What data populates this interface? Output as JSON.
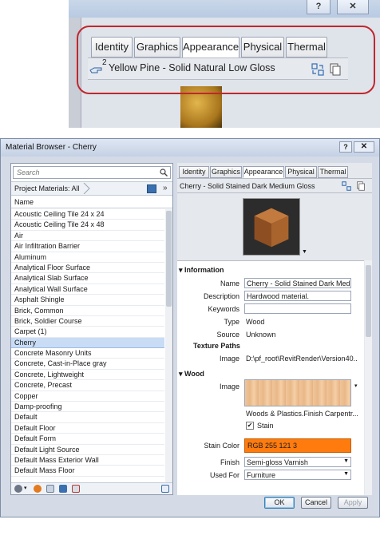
{
  "zoom": {
    "tabs": [
      "Identity",
      "Graphics",
      "Appearance",
      "Physical",
      "Thermal"
    ],
    "active_tab": "Appearance",
    "asset_superscript": "2",
    "asset_name": "Yellow Pine - Solid Natural Low Gloss",
    "help_button": "?",
    "close_button": "✕"
  },
  "dialog": {
    "title": "Material Browser - Cherry",
    "help_button": "?",
    "close_button": "✕",
    "search": {
      "placeholder": "Search"
    },
    "breadcrumb": "Project Materials: All",
    "expand_chevron": "»",
    "column_header": "Name",
    "materials": [
      "Acoustic Ceiling Tile 24 x 24",
      "Acoustic Ceiling Tile 24 x 48",
      "Air",
      "Air Infiltration Barrier",
      "Aluminum",
      "Analytical Floor Surface",
      "Analytical Slab Surface",
      "Analytical Wall Surface",
      "Asphalt Shingle",
      "Brick, Common",
      "Brick, Soldier Course",
      "Carpet (1)",
      "Cherry",
      "Concrete Masonry Units",
      "Concrete, Cast-in-Place gray",
      "Concrete, Lightweight",
      "Concrete, Precast",
      "Copper",
      "Damp-proofing",
      "Default",
      "Default Floor",
      "Default Form",
      "Default Light Source",
      "Default Mass Exterior Wall",
      "Default Mass Floor"
    ],
    "selected_material": "Cherry",
    "tabs": [
      "Identity",
      "Graphics",
      "Appearance",
      "Physical",
      "Thermal"
    ],
    "active_tab": "Appearance",
    "asset_name": "Cherry - Solid Stained Dark Medium Gloss",
    "information": {
      "header": "Information",
      "name_label": "Name",
      "name_value": "Cherry - Solid Stained Dark Med...",
      "description_label": "Description",
      "description_value": "Hardwood material.",
      "keywords_label": "Keywords",
      "keywords_value": "",
      "type_label": "Type",
      "type_value": "Wood",
      "source_label": "Source",
      "source_value": "Unknown",
      "texture_paths_header": "Texture Paths",
      "image_label": "Image",
      "image_value": "D:\\pf_root\\RevitRender\\Version40..."
    },
    "wood": {
      "header": "Wood",
      "image_label": "Image",
      "image_caption": "Woods & Plastics.Finish Carpentr...",
      "stain_label": "Stain",
      "stain_checked": true,
      "stain_color_label": "Stain Color",
      "stain_color_value": "RGB 255 121 3",
      "stain_color_hex": "#ff7903",
      "finish_label": "Finish",
      "finish_value": "Semi-gloss Varnish",
      "used_for_label": "Used For",
      "used_for_value": "Furniture"
    },
    "buttons": {
      "ok": "OK",
      "cancel": "Cancel",
      "apply": "Apply"
    }
  }
}
